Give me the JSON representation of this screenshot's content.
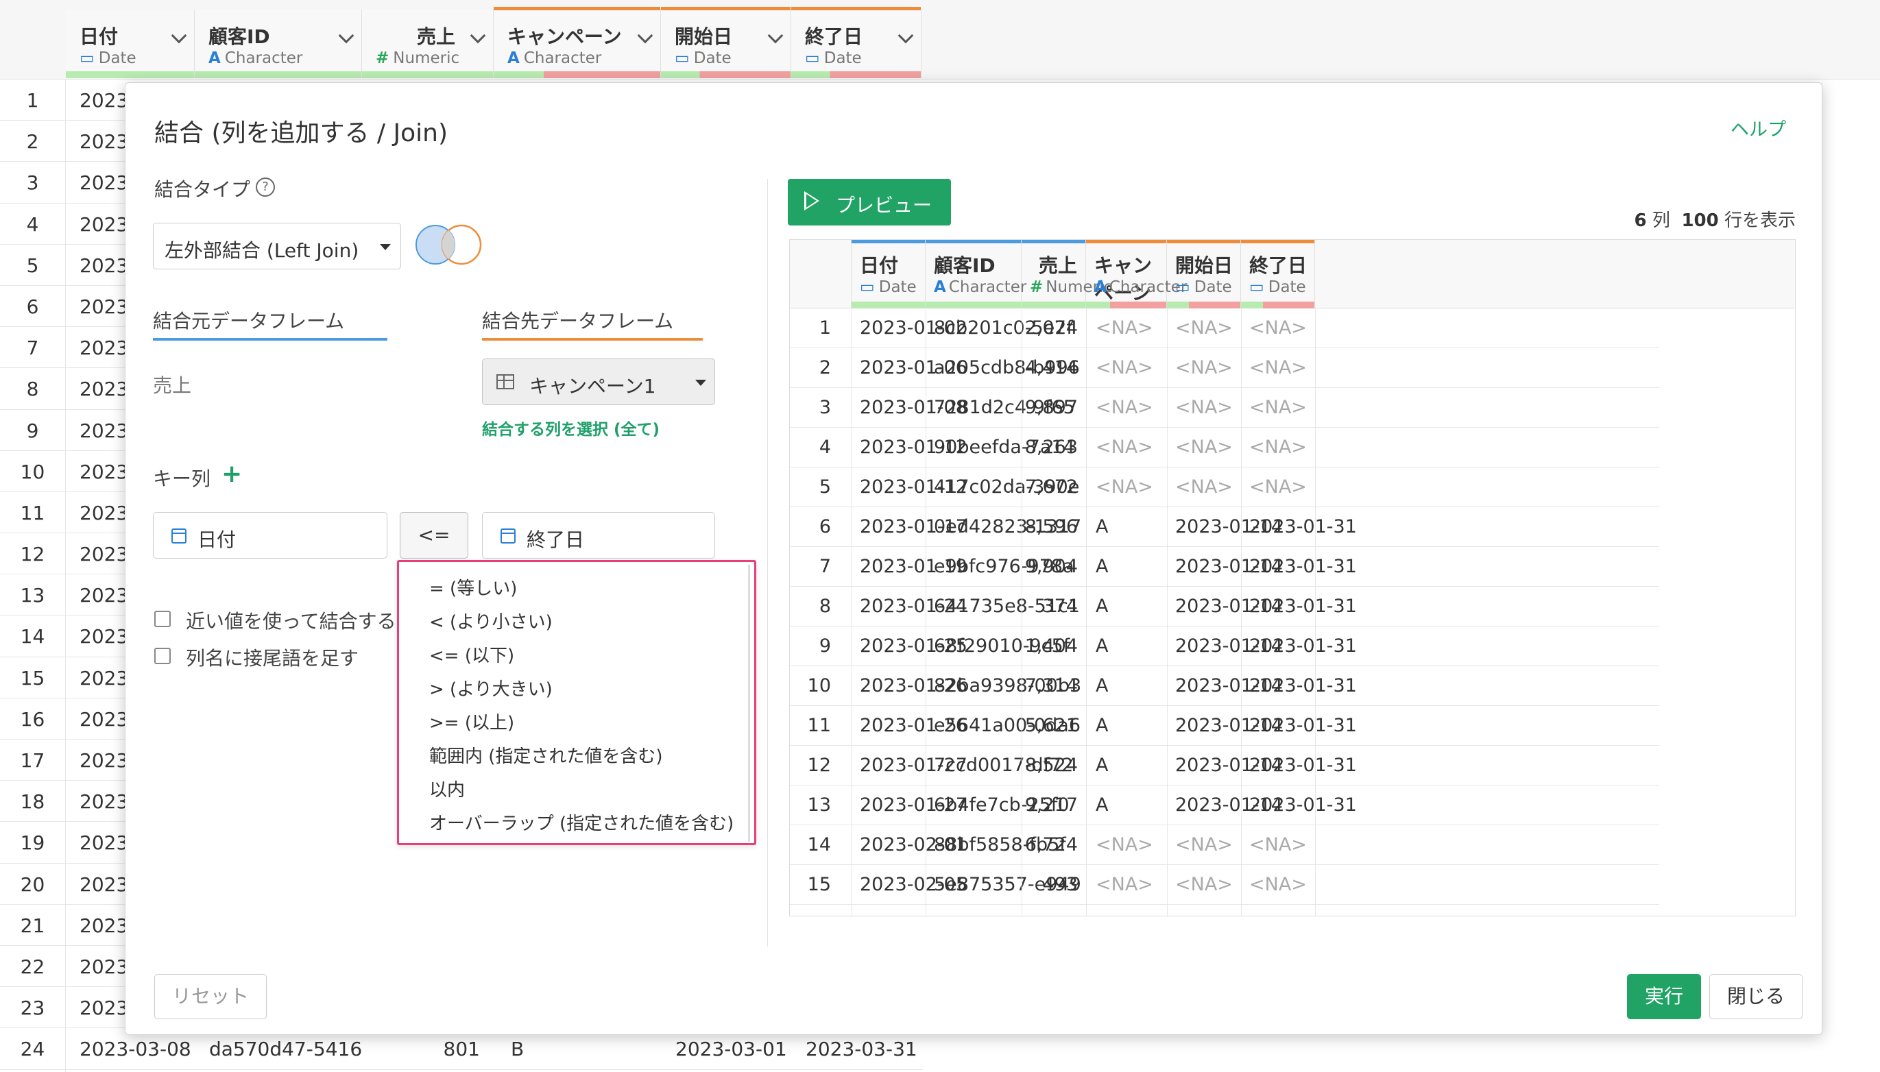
{
  "background": {
    "columns": [
      {
        "name": "日付",
        "type_icon": "calendar-icon",
        "type": "Date"
      },
      {
        "name": "顧客ID",
        "type_icon": "A",
        "type": "Character"
      },
      {
        "name": "売上",
        "type_icon": "#",
        "type": "Numeric"
      },
      {
        "name": "キャンペーン",
        "type_icon": "A",
        "type": "Character"
      },
      {
        "name": "開始日",
        "type_icon": "calendar-icon",
        "type": "Date"
      },
      {
        "name": "終了日",
        "type_icon": "calendar-icon",
        "type": "Date"
      }
    ],
    "row_numbers": [
      "1",
      "2",
      "3",
      "4",
      "5",
      "6",
      "7",
      "8",
      "9",
      "10",
      "11",
      "12",
      "13",
      "14",
      "15",
      "16",
      "17",
      "18",
      "19",
      "20",
      "21",
      "22",
      "23",
      "24"
    ],
    "partial_value": "2023",
    "last_row": {
      "date": "2023-03-08",
      "id": "da570d47-5416",
      "sales": "801",
      "campaign": "B",
      "start": "2023-03-01",
      "end": "2023-03-31"
    }
  },
  "dialog": {
    "title": "結合 (列を追加する / Join)",
    "help": "ヘルプ",
    "join_type_label": "結合タイプ",
    "join_type_help": "?",
    "join_type_value": "左外部結合 (Left Join)",
    "source_tab": "結合元データフレーム",
    "target_tab": "結合先データフレーム",
    "source_name": "売上",
    "target_value": "キャンペーン1",
    "select_columns_link": "結合する列を選択 (全て)",
    "key_label": "キー列",
    "key_add": "+",
    "key_left": "日付",
    "key_operator": "<=",
    "key_right": "終了日",
    "operator_options": [
      "= (等しい)",
      "< (より小さい)",
      "<= (以下)",
      "> (より大きい)",
      ">= (以上)",
      "範囲内 (指定された値を含む)",
      "以内",
      "オーバーラップ (指定された値を含む)"
    ],
    "checkbox_nearest": "近い値を使って結合する",
    "checkbox_suffix": "列名に接尾語を足す",
    "preview_button": "プレビュー",
    "count_cols": "6",
    "count_cols_unit": "列",
    "count_rows": "100",
    "count_rows_unit": "行を表示",
    "reset": "リセット",
    "run": "実行",
    "close": "閉じる"
  },
  "preview_table": {
    "columns": [
      {
        "name": "日付",
        "type": "Date"
      },
      {
        "name": "顧客ID",
        "type": "Character"
      },
      {
        "name": "売上",
        "type": "Numeric"
      },
      {
        "name": "キャンペーン",
        "type": "Character"
      },
      {
        "name": "開始日",
        "type": "Date"
      },
      {
        "name": "終了日",
        "type": "Date"
      }
    ],
    "rows": [
      [
        "1",
        "2023-01-02",
        "8cb201c0-5e2f",
        "2,074",
        "<NA>",
        "<NA>",
        "<NA>"
      ],
      [
        "2",
        "2023-01-06",
        "a205cdb8-b996",
        "4,414",
        "<NA>",
        "<NA>",
        "<NA>"
      ],
      [
        "3",
        "2023-01-08",
        "7281d2c4-9f65",
        "9,897",
        "<NA>",
        "<NA>",
        "<NA>"
      ],
      [
        "4",
        "2023-01-12",
        "90beefda-7a14",
        "8,263",
        "<NA>",
        "<NA>",
        "<NA>"
      ],
      [
        "5",
        "2023-01-12",
        "417c02da-390e",
        "7,672",
        "<NA>",
        "<NA>",
        "<NA>"
      ],
      [
        "6",
        "2023-01-17",
        "0ed42823-1317",
        "8,596",
        "A",
        "2023-01-14",
        "2023-01-31"
      ],
      [
        "7",
        "2023-01-19",
        "e9bfc976-978a",
        "9,904",
        "A",
        "2023-01-14",
        "2023-01-31"
      ],
      [
        "8",
        "2023-01-24",
        "641735e8-51c1",
        "374",
        "A",
        "2023-01-14",
        "2023-01-31"
      ],
      [
        "9",
        "2023-01-25",
        "68f29010-9c5f",
        "1,404",
        "A",
        "2023-01-14",
        "2023-01-31"
      ],
      [
        "10",
        "2023-01-26",
        "82ba9398-00b3",
        "7,314",
        "A",
        "2023-01-14",
        "2023-01-31"
      ],
      [
        "11",
        "2023-01-26",
        "e5641a00-0da6",
        "5,621",
        "A",
        "2023-01-14",
        "2023-01-31"
      ],
      [
        "12",
        "2023-01-27",
        "7ccd0017-df72",
        "8,524",
        "A",
        "2023-01-14",
        "2023-01-31"
      ],
      [
        "13",
        "2023-01-27",
        "6b4fe7cb-25f0",
        "9,217",
        "A",
        "2023-01-14",
        "2023-01-31"
      ],
      [
        "14",
        "2023-02-01",
        "88bf5858-fb5f",
        "6,724",
        "<NA>",
        "<NA>",
        "<NA>"
      ],
      [
        "15",
        "2023-02-05",
        "5e875357-e949",
        "493",
        "<NA>",
        "<NA>",
        "<NA>"
      ]
    ]
  },
  "colors": {
    "accent": "#21a366",
    "source": "#4a9be0",
    "target": "#ef8c3a",
    "highlight": "#e83e7a",
    "match": "#b8ebb0",
    "missing": "#f2a0a0"
  }
}
